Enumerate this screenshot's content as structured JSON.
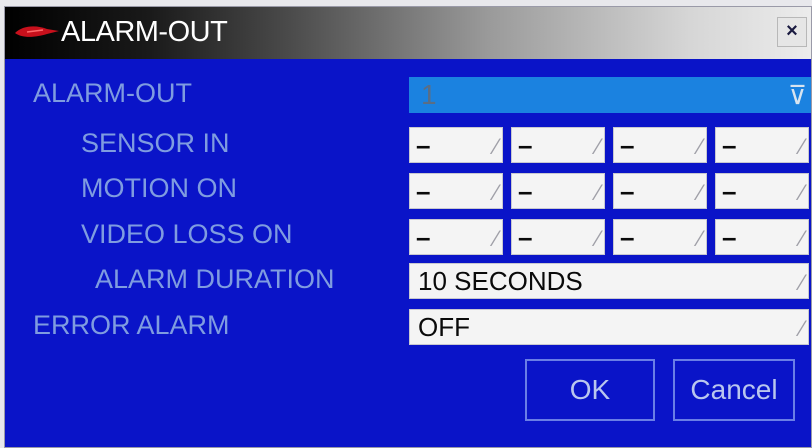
{
  "window": {
    "title": "ALARM-OUT",
    "close_label": "×"
  },
  "labels": {
    "alarm_out": "ALARM-OUT",
    "sensor_in": "SENSOR IN",
    "motion_on": "MOTION ON",
    "video_loss_on": "VIDEO LOSS ON",
    "alarm_duration": "ALARM DURATION",
    "error_alarm": "ERROR ALARM"
  },
  "fields": {
    "alarm_out_value": "1",
    "sensor_in": [
      "–",
      "–",
      "–",
      "–"
    ],
    "motion_on": [
      "–",
      "–",
      "–",
      "–"
    ],
    "video_loss_on": [
      "–",
      "–",
      "–",
      "–"
    ],
    "alarm_duration_value": "10 SECONDS",
    "error_alarm_value": "OFF"
  },
  "buttons": {
    "ok_label": "OK",
    "cancel_label": "Cancel"
  },
  "colors": {
    "window_background": "#0a14c8",
    "label_text": "#7f9ce0",
    "selected_field": "#1b82e0",
    "field_background": "#f4f4f4"
  },
  "icons": {
    "title_logo": "red-swoosh-logo",
    "close": "close-icon",
    "dropdown": "dropdown-arrow-icon"
  }
}
